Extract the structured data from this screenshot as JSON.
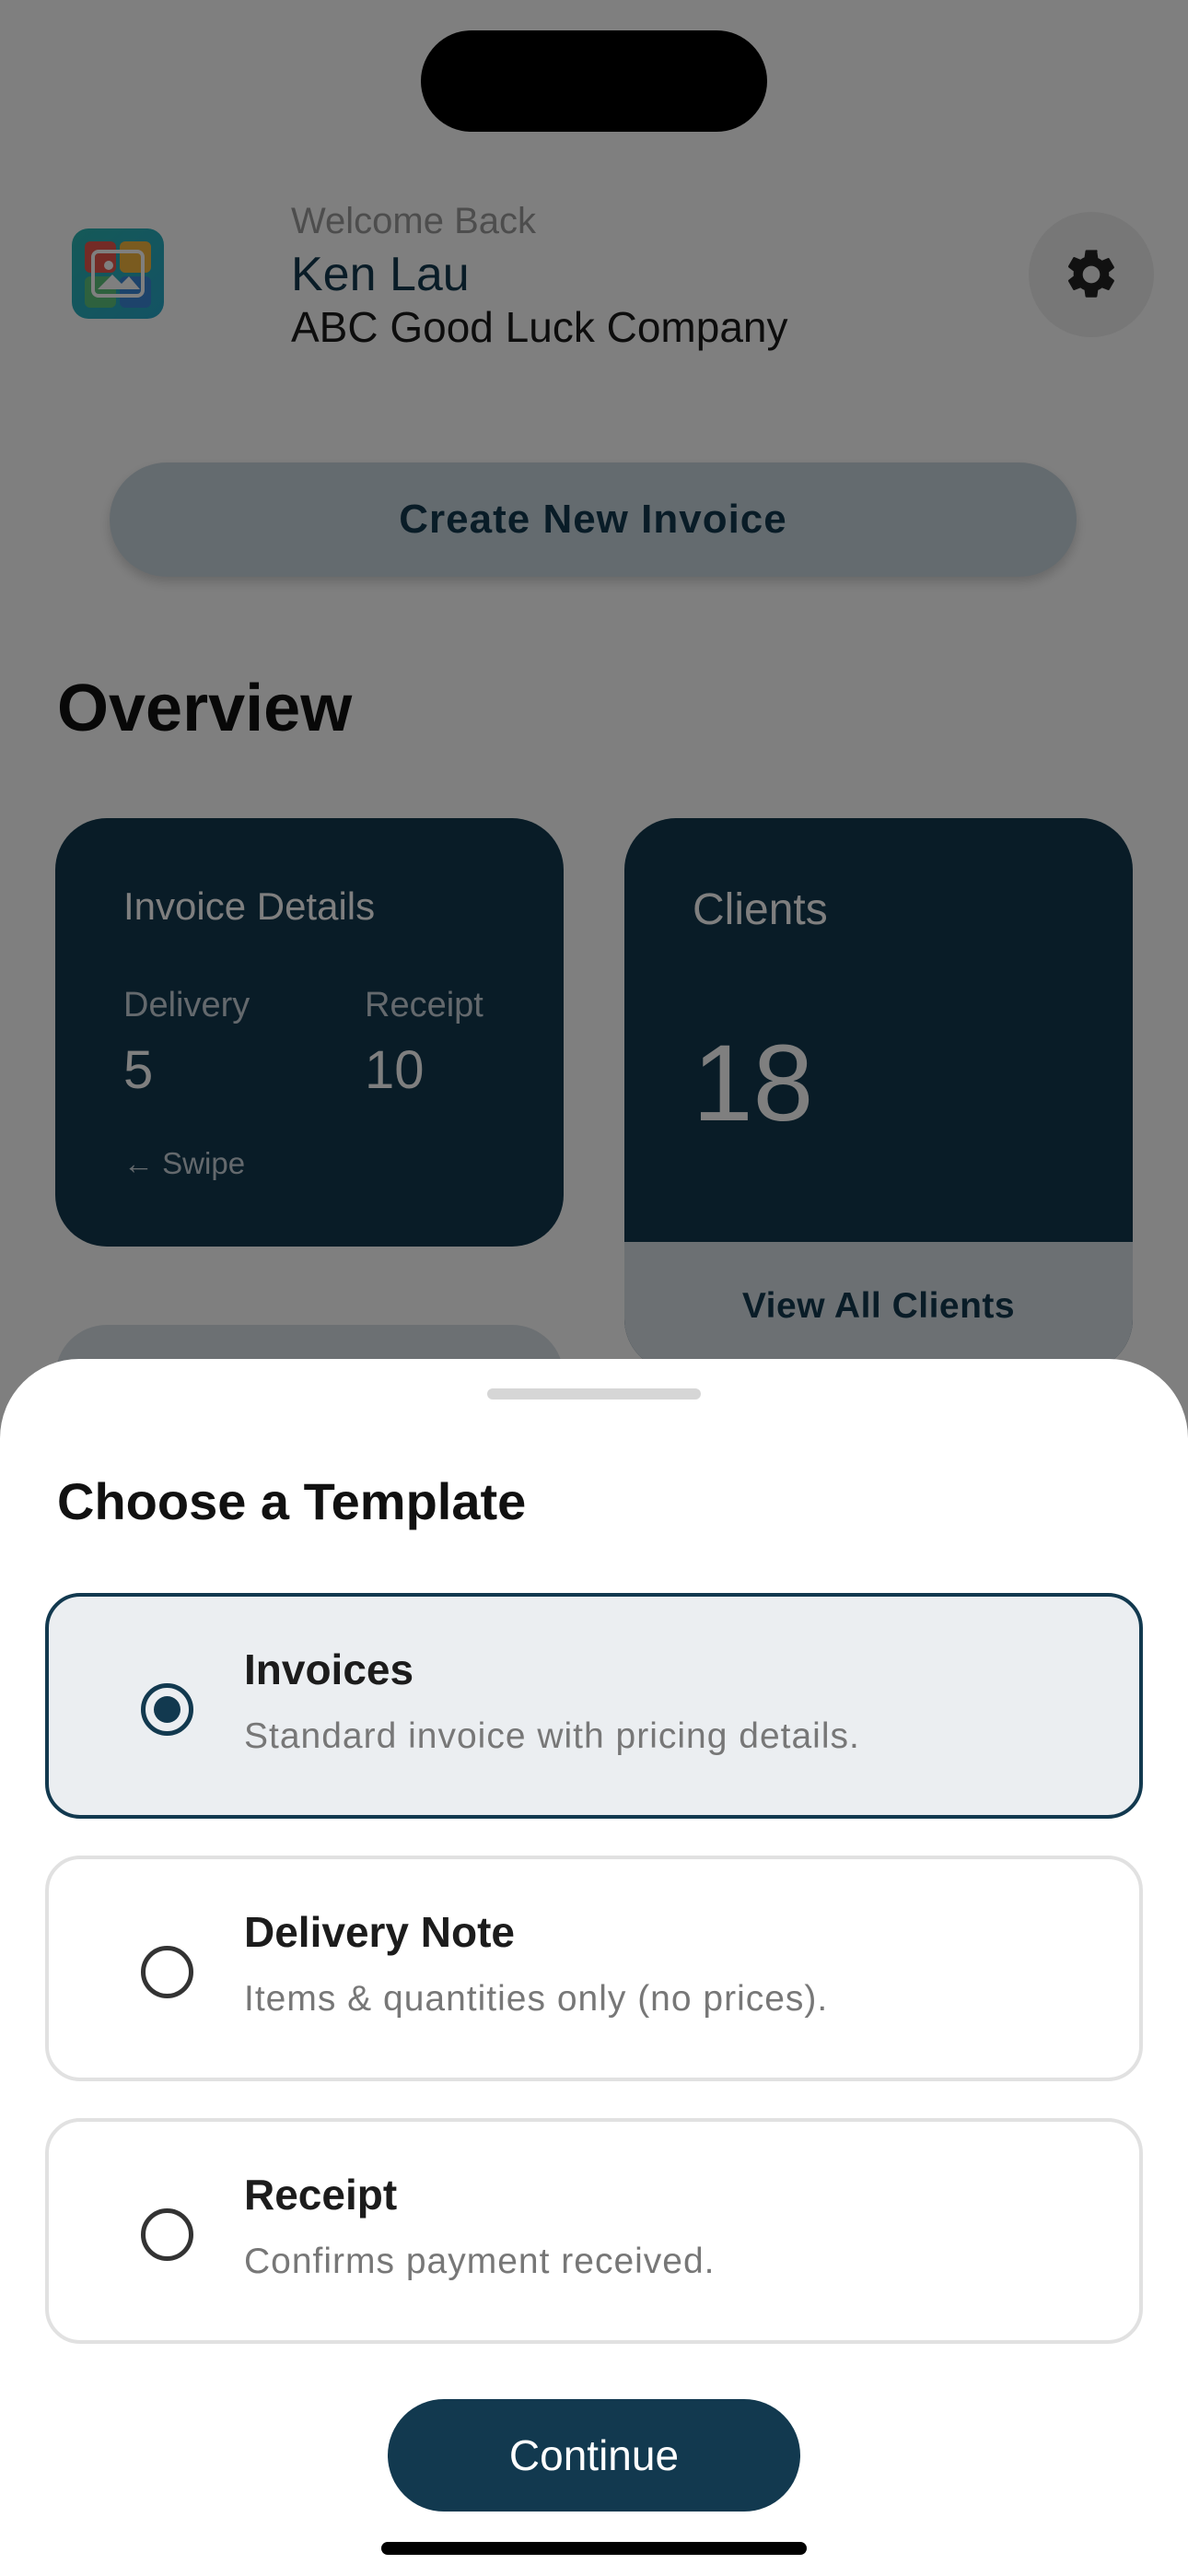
{
  "header": {
    "welcome": "Welcome Back",
    "user_name": "Ken Lau",
    "company": "ABC Good Luck Company"
  },
  "actions": {
    "create_invoice": "Create New Invoice"
  },
  "overview": {
    "title": "Overview",
    "invoice_card": {
      "title": "Invoice Details",
      "delivery_label": "Delivery",
      "delivery_value": "5",
      "receipt_label": "Receipt",
      "receipt_value": "10",
      "swipe_hint": "← Swipe"
    },
    "clients_card": {
      "title": "Clients",
      "count": "18",
      "view_all": "View All Clients"
    }
  },
  "sheet": {
    "title": "Choose a Template",
    "options": [
      {
        "title": "Invoices",
        "description": "Standard invoice with pricing details.",
        "selected": true
      },
      {
        "title": "Delivery Note",
        "description": "Items & quantities only (no prices).",
        "selected": false
      },
      {
        "title": "Receipt",
        "description": "Confirms payment received.",
        "selected": false
      }
    ],
    "continue_label": "Continue"
  },
  "colors": {
    "primary": "#12394f",
    "selected_bg": "#ebeef1",
    "overlay": "rgba(0,0,0,0.5)"
  },
  "icons": {
    "app_logo": "image-gallery-icon",
    "settings": "gear-icon"
  }
}
